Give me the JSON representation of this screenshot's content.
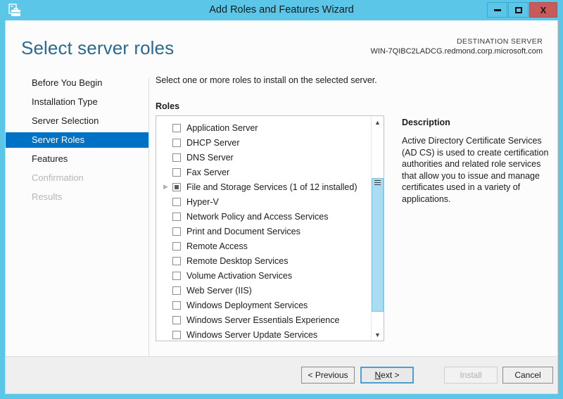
{
  "window": {
    "title": "Add Roles and Features Wizard",
    "app_icon": "server-toolbox-icon",
    "controls": {
      "minimize": "minimize-icon",
      "maximize": "maximize-icon",
      "close": "X"
    }
  },
  "header": {
    "page_title": "Select server roles",
    "destination_label": "DESTINATION SERVER",
    "destination_server": "WIN-7QIBC2LADCG.redmond.corp.microsoft.com"
  },
  "sidebar": {
    "items": [
      {
        "label": "Before You Begin",
        "state": "normal"
      },
      {
        "label": "Installation Type",
        "state": "normal"
      },
      {
        "label": "Server Selection",
        "state": "normal"
      },
      {
        "label": "Server Roles",
        "state": "selected"
      },
      {
        "label": "Features",
        "state": "normal"
      },
      {
        "label": "Confirmation",
        "state": "disabled"
      },
      {
        "label": "Results",
        "state": "disabled"
      }
    ]
  },
  "main": {
    "instruction": "Select one or more roles to install on the selected server.",
    "roles_label": "Roles",
    "roles": [
      {
        "label": "Application Server",
        "checked": false,
        "expandable": false
      },
      {
        "label": "DHCP Server",
        "checked": false,
        "expandable": false
      },
      {
        "label": "DNS Server",
        "checked": false,
        "expandable": false
      },
      {
        "label": "Fax Server",
        "checked": false,
        "expandable": false
      },
      {
        "label": "File and Storage Services (1 of 12 installed)",
        "checked": "partial",
        "expandable": true
      },
      {
        "label": "Hyper-V",
        "checked": false,
        "expandable": false
      },
      {
        "label": "Network Policy and Access Services",
        "checked": false,
        "expandable": false
      },
      {
        "label": "Print and Document Services",
        "checked": false,
        "expandable": false
      },
      {
        "label": "Remote Access",
        "checked": false,
        "expandable": false
      },
      {
        "label": "Remote Desktop Services",
        "checked": false,
        "expandable": false
      },
      {
        "label": "Volume Activation Services",
        "checked": false,
        "expandable": false
      },
      {
        "label": "Web Server (IIS)",
        "checked": false,
        "expandable": false
      },
      {
        "label": "Windows Deployment Services",
        "checked": false,
        "expandable": false
      },
      {
        "label": "Windows Server Essentials Experience",
        "checked": false,
        "expandable": false
      },
      {
        "label": "Windows Server Update Services",
        "checked": false,
        "expandable": false
      }
    ]
  },
  "description": {
    "title": "Description",
    "body": "Active Directory Certificate Services (AD CS) is used to create certification authorities and related role services that allow you to issue and manage certificates used in a variety of applications."
  },
  "footer": {
    "previous": "< Previous",
    "next_prefix": "N",
    "next_suffix": "ext >",
    "install": "Install",
    "cancel": "Cancel"
  },
  "colors": {
    "titlebar": "#5bc6e8",
    "accent_selected": "#0072c6",
    "page_title": "#2a6a91",
    "close_button": "#c75b5b",
    "scroll_thumb": "#aadcf2",
    "footer_bg": "#efefef"
  }
}
